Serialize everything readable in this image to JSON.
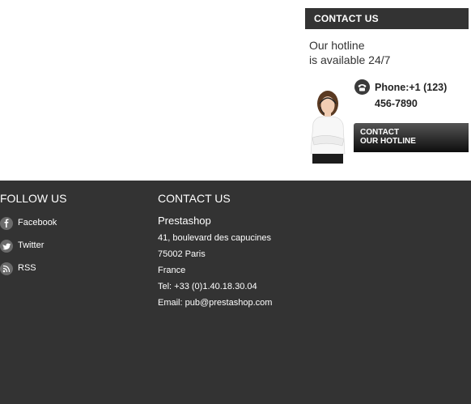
{
  "contact_block": {
    "header": "CONTACT US",
    "hotline_line1": "Our hotline",
    "hotline_line2": "is available 24/7",
    "phone_line1": "Phone:+1 (123)",
    "phone_line2": "456-7890",
    "button_line1": "CONTACT",
    "button_line2": "OUR HOTLINE"
  },
  "footer": {
    "follow": {
      "title": "FOLLOW US",
      "items": [
        {
          "label": "Facebook",
          "icon": "facebook-icon"
        },
        {
          "label": "Twitter",
          "icon": "twitter-icon"
        },
        {
          "label": "RSS",
          "icon": "rss-icon"
        }
      ]
    },
    "contact": {
      "title": "CONTACT US",
      "company": "Prestashop",
      "address": "41, boulevard des capucines",
      "postal": "75002 Paris",
      "country": "France",
      "tel": "Tel: +33 (0)1.40.18.30.04",
      "email": "Email: pub@prestashop.com"
    }
  },
  "colors": {
    "dark": "#333333",
    "text_dark": "#222222",
    "white": "#ffffff"
  }
}
